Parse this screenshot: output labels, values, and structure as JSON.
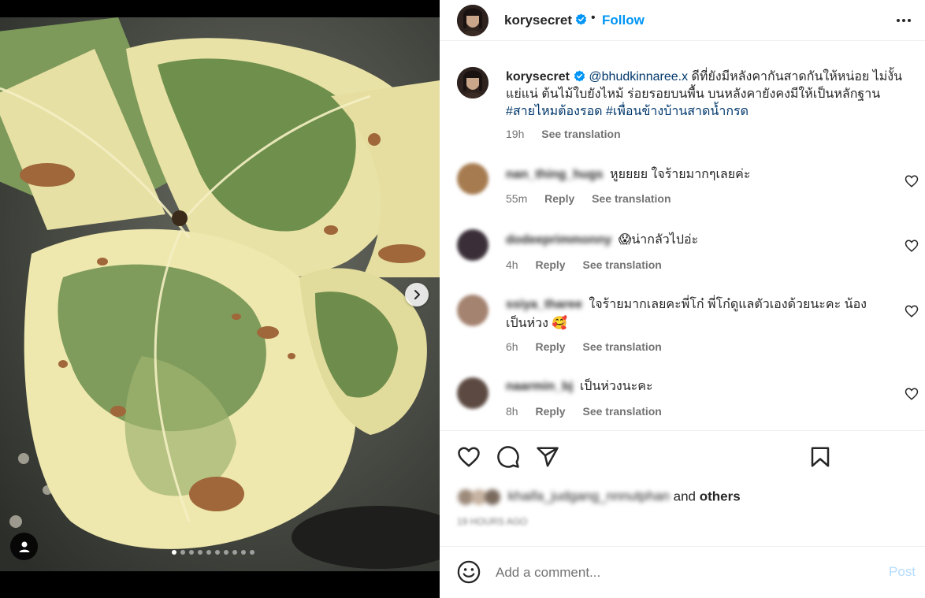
{
  "header": {
    "username": "korysecret",
    "separator": "•",
    "follow_label": "Follow"
  },
  "caption": {
    "username": "korysecret",
    "mention": "@bhudkinnaree.x",
    "text": " ดีที่ยังมีหลังคากันสาดกันให้หน่อย ไม่งั้นแย่แน่ ต้นไม้ใบยังไหม้ ร่อยรอยบนพื้น บนหลังคายังคงมีให้เป็นหลักฐาน ",
    "hashtags": "#สายไหมต้องรอด #เพื่อนข้างบ้านสาดน้ำกรด",
    "time": "19h",
    "see_translation": "See translation"
  },
  "comments": [
    {
      "username": "nan_thing_hugs",
      "text": "หูยยยย ใจร้ายมากๆเลยค่ะ",
      "time": "55m",
      "reply": "Reply",
      "see_translation": "See translation"
    },
    {
      "username": "dodeeprimmonny",
      "text": "😱น่ากลัวไปอ่ะ",
      "time": "4h",
      "reply": "Reply",
      "see_translation": "See translation"
    },
    {
      "username": "ssiya_tharee",
      "text": "ใจร้ายมากเลยคะพี่โก๋ พี่โก๋ดูแลตัวเองด้วยนะคะ น้องเป็นห่วง 🥰",
      "time": "6h",
      "reply": "Reply",
      "see_translation": "See translation"
    },
    {
      "username": "naarmin_bj",
      "text": "เป็นห่วงนะคะ",
      "time": "8h",
      "reply": "Reply",
      "see_translation": "See translation"
    }
  ],
  "likes": {
    "blurred_names": "khaifa_judgang_nnnutphan",
    "and_label": "and",
    "others_label": "others",
    "time_ago": "19 HOURS AGO"
  },
  "add_comment": {
    "placeholder": "Add a comment...",
    "post_label": "Post"
  },
  "carousel": {
    "total_slides": 10,
    "active_index": 0
  },
  "colors": {
    "accent": "#0095f6",
    "link": "#00376b",
    "muted": "#737373",
    "post_disabled": "#b3dbff",
    "verified": "#0095f6"
  },
  "icons": {
    "next": "chevron-right-icon",
    "tag": "user-tag-icon",
    "more": "more-horizontal-icon",
    "like": "heart-icon",
    "comment": "comment-icon",
    "share": "share-icon",
    "save": "bookmark-icon",
    "emoji": "emoji-icon"
  }
}
